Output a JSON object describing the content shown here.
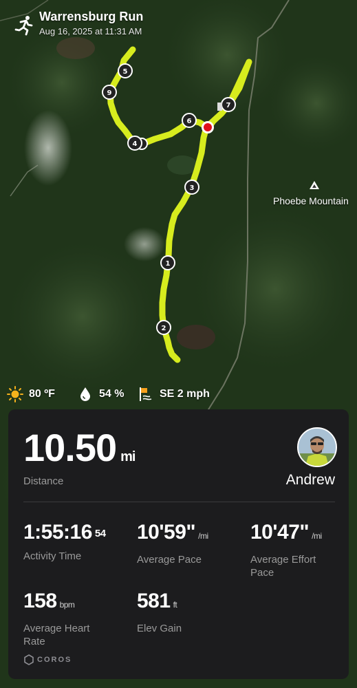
{
  "header": {
    "title": "Warrensburg Run",
    "date": "Aug 16, 2025 at 11:31 AM",
    "activity_icon": "running-person-icon"
  },
  "map": {
    "poi_name": "Phoebe Mountain",
    "poi_icon": "mountain-peak-icon",
    "route_color": "#d7ec1e",
    "lap_markers": [
      "1",
      "2",
      "3",
      "4",
      "5",
      "6",
      "7",
      "9"
    ]
  },
  "weather": {
    "temperature": "80 ºF",
    "humidity": "54 %",
    "wind": "SE 2 mph"
  },
  "summary": {
    "distance": "10.50",
    "distance_unit": "mi",
    "distance_label": "Distance",
    "user_name": "Andrew",
    "stats": [
      {
        "value": "1:55:16",
        "sup": "54",
        "unit": "",
        "label": "Activity Time"
      },
      {
        "value": "10'59\"",
        "sup": "",
        "unit": "/mi",
        "label": "Average Pace"
      },
      {
        "value": "10'47\"",
        "sup": "",
        "unit": "/mi",
        "label": "Average Effort Pace"
      },
      {
        "value": "158",
        "sup": "",
        "unit": "bpm",
        "label": "Average Heart Rate"
      },
      {
        "value": "581",
        "sup": "",
        "unit": "ft",
        "label": "Elev Gain"
      }
    ],
    "brand": "COROS"
  },
  "colors": {
    "card_background": "#1c1c1e",
    "label_gray": "#9a9a9a",
    "route": "#d7ec1e"
  }
}
